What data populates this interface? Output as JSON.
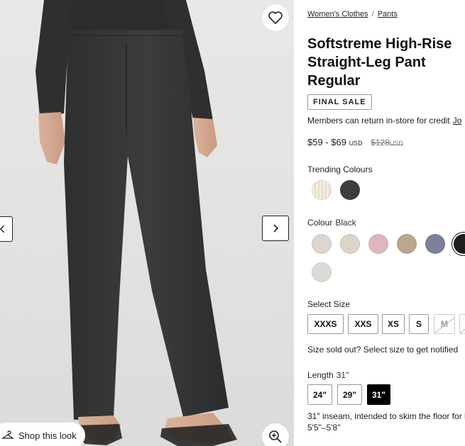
{
  "gallery": {
    "shop_look_label": "Shop this look"
  },
  "breadcrumb": {
    "items": [
      "Women's Clothes",
      "Pants"
    ],
    "separator": "/"
  },
  "product": {
    "title_lines": [
      "Softstreme High-Rise",
      "Straight-Leg Pant",
      "Regular"
    ],
    "badge": "FINAL SALE",
    "members_text": "Members can return in-store for credit",
    "members_link": "Jo",
    "price_range": "$59 - $69",
    "price_currency": "USD",
    "original_price": "$128",
    "original_currency": "USD"
  },
  "trending": {
    "label": "Trending Colours",
    "swatches": [
      {
        "name": "cream-rib",
        "color": "#f1e9dc"
      },
      {
        "name": "charcoal",
        "color": "#3b3d3c"
      }
    ]
  },
  "colour": {
    "label": "Colour",
    "selected": "Black",
    "swatches": [
      {
        "color": "#dcd6ce"
      },
      {
        "color": "#ddd3c7"
      },
      {
        "color": "#dfb6bf"
      },
      {
        "color": "#b9a88e"
      },
      {
        "color": "#7b819a"
      },
      {
        "color": "#1f1f1f"
      },
      {
        "color": "#dddbd5"
      }
    ]
  },
  "size": {
    "label": "Select Size",
    "options": [
      {
        "label": "XXXS",
        "available": true
      },
      {
        "label": "XXS",
        "available": true
      },
      {
        "label": "XS",
        "available": true
      },
      {
        "label": "S",
        "available": true
      },
      {
        "label": "M",
        "available": false
      },
      {
        "label": "",
        "available": false
      }
    ],
    "sold_out_note": "Size sold out? Select size to get notified"
  },
  "length": {
    "label": "Length",
    "selected": "31\"",
    "options": [
      "24\"",
      "29\"",
      "31\""
    ],
    "description_line1": "31\" inseam, intended to skim the floor for h",
    "description_line2": "5'5\"–5'8\""
  }
}
